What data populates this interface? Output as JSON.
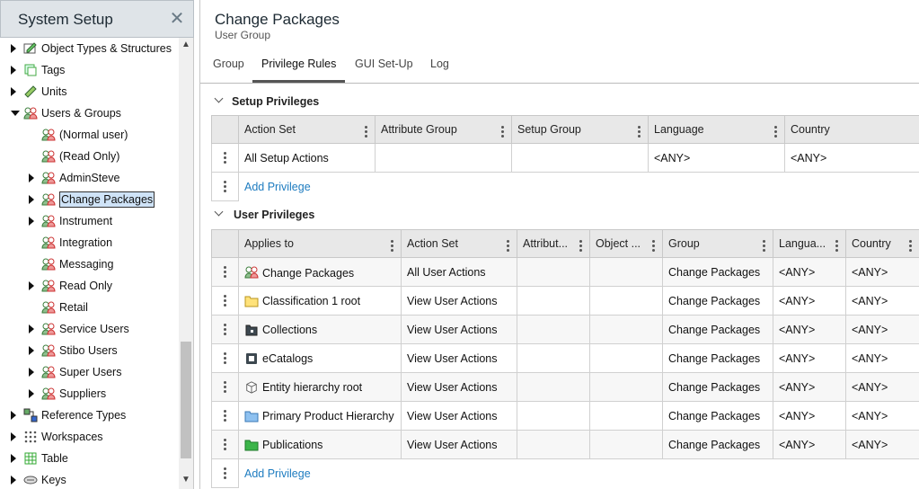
{
  "left_panel": {
    "title": "System Setup",
    "tree": [
      {
        "label": "Object Types & Structures",
        "level": 0,
        "state": "collapsed",
        "icon": "object-types-icon"
      },
      {
        "label": "Tags",
        "level": 0,
        "state": "collapsed",
        "icon": "tags-icon"
      },
      {
        "label": "Units",
        "level": 0,
        "state": "collapsed",
        "icon": "ruler-icon"
      },
      {
        "label": "Users & Groups",
        "level": 0,
        "state": "expanded",
        "icon": "users-icon"
      },
      {
        "label": "(Normal user)",
        "level": 1,
        "state": "leaf",
        "icon": "users-icon"
      },
      {
        "label": "(Read Only)",
        "level": 1,
        "state": "leaf",
        "icon": "users-icon"
      },
      {
        "label": "AdminSteve",
        "level": 1,
        "state": "collapsed",
        "icon": "users-icon"
      },
      {
        "label": "Change Packages",
        "level": 1,
        "state": "collapsed",
        "icon": "users-icon",
        "selected": true
      },
      {
        "label": "Instrument",
        "level": 1,
        "state": "collapsed",
        "icon": "users-icon"
      },
      {
        "label": "Integration",
        "level": 1,
        "state": "leaf",
        "icon": "users-icon"
      },
      {
        "label": "Messaging",
        "level": 1,
        "state": "leaf",
        "icon": "users-icon"
      },
      {
        "label": "Read Only",
        "level": 1,
        "state": "collapsed",
        "icon": "users-icon"
      },
      {
        "label": "Retail",
        "level": 1,
        "state": "leaf",
        "icon": "users-icon"
      },
      {
        "label": "Service Users",
        "level": 1,
        "state": "collapsed",
        "icon": "users-icon"
      },
      {
        "label": "Stibo Users",
        "level": 1,
        "state": "collapsed",
        "icon": "users-icon"
      },
      {
        "label": "Super Users",
        "level": 1,
        "state": "collapsed",
        "icon": "users-icon"
      },
      {
        "label": "Suppliers",
        "level": 1,
        "state": "collapsed",
        "icon": "users-icon"
      },
      {
        "label": "Reference Types",
        "level": 0,
        "state": "collapsed",
        "icon": "reference-types-icon"
      },
      {
        "label": "Workspaces",
        "level": 0,
        "state": "collapsed",
        "icon": "workspaces-icon"
      },
      {
        "label": "Table",
        "level": 0,
        "state": "collapsed",
        "icon": "table-icon"
      },
      {
        "label": "Keys",
        "level": 0,
        "state": "collapsed",
        "icon": "keys-icon"
      }
    ]
  },
  "main": {
    "title": "Change Packages",
    "subtitle": "User Group",
    "tabs": [
      {
        "label": "Group",
        "active": false
      },
      {
        "label": "Privilege Rules",
        "active": true
      },
      {
        "label": "GUI Set-Up",
        "active": false
      },
      {
        "label": "Log",
        "active": false
      }
    ],
    "setup_privileges": {
      "header": "Setup Privileges",
      "columns": [
        "Action Set",
        "Attribute Group",
        "Setup Group",
        "Language",
        "Country"
      ],
      "rows": [
        [
          "All Setup Actions",
          "",
          "",
          "<ANY>",
          "<ANY>"
        ]
      ],
      "add_label": "Add Privilege"
    },
    "user_privileges": {
      "header": "User Privileges",
      "columns": [
        "Applies to",
        "Action Set",
        "Attribut...",
        "Object ...",
        "Group",
        "Langua...",
        "Country"
      ],
      "rows": [
        {
          "applies_to": "Change Packages",
          "icon": "users-icon",
          "action_set": "All User Actions",
          "attribute": "",
          "object": "",
          "group": "Change Packages",
          "language": "<ANY>",
          "country": "<ANY>"
        },
        {
          "applies_to": "Classification 1 root",
          "icon": "yellow-folder-icon",
          "action_set": "View User Actions",
          "attribute": "",
          "object": "",
          "group": "Change Packages",
          "language": "<ANY>",
          "country": "<ANY>"
        },
        {
          "applies_to": "Collections",
          "icon": "dark-folder-icon",
          "action_set": "View User Actions",
          "attribute": "",
          "object": "",
          "group": "Change Packages",
          "language": "<ANY>",
          "country": "<ANY>"
        },
        {
          "applies_to": "eCatalogs",
          "icon": "ecatalog-icon",
          "action_set": "View User Actions",
          "attribute": "",
          "object": "",
          "group": "Change Packages",
          "language": "<ANY>",
          "country": "<ANY>"
        },
        {
          "applies_to": "Entity hierarchy root",
          "icon": "cube-icon",
          "action_set": "View User Actions",
          "attribute": "",
          "object": "",
          "group": "Change Packages",
          "language": "<ANY>",
          "country": "<ANY>"
        },
        {
          "applies_to": "Primary Product Hierarchy",
          "icon": "blue-folder-icon",
          "action_set": "View User Actions",
          "attribute": "",
          "object": "",
          "group": "Change Packages",
          "language": "<ANY>",
          "country": "<ANY>"
        },
        {
          "applies_to": "Publications",
          "icon": "green-folder-icon",
          "action_set": "View User Actions",
          "attribute": "",
          "object": "",
          "group": "Change Packages",
          "language": "<ANY>",
          "country": "<ANY>"
        }
      ],
      "add_label": "Add Privilege"
    }
  },
  "colors": {
    "header_bg": "#dfe4e8",
    "link": "#1e7cc0",
    "selected_bg": "#cfe3f7"
  }
}
